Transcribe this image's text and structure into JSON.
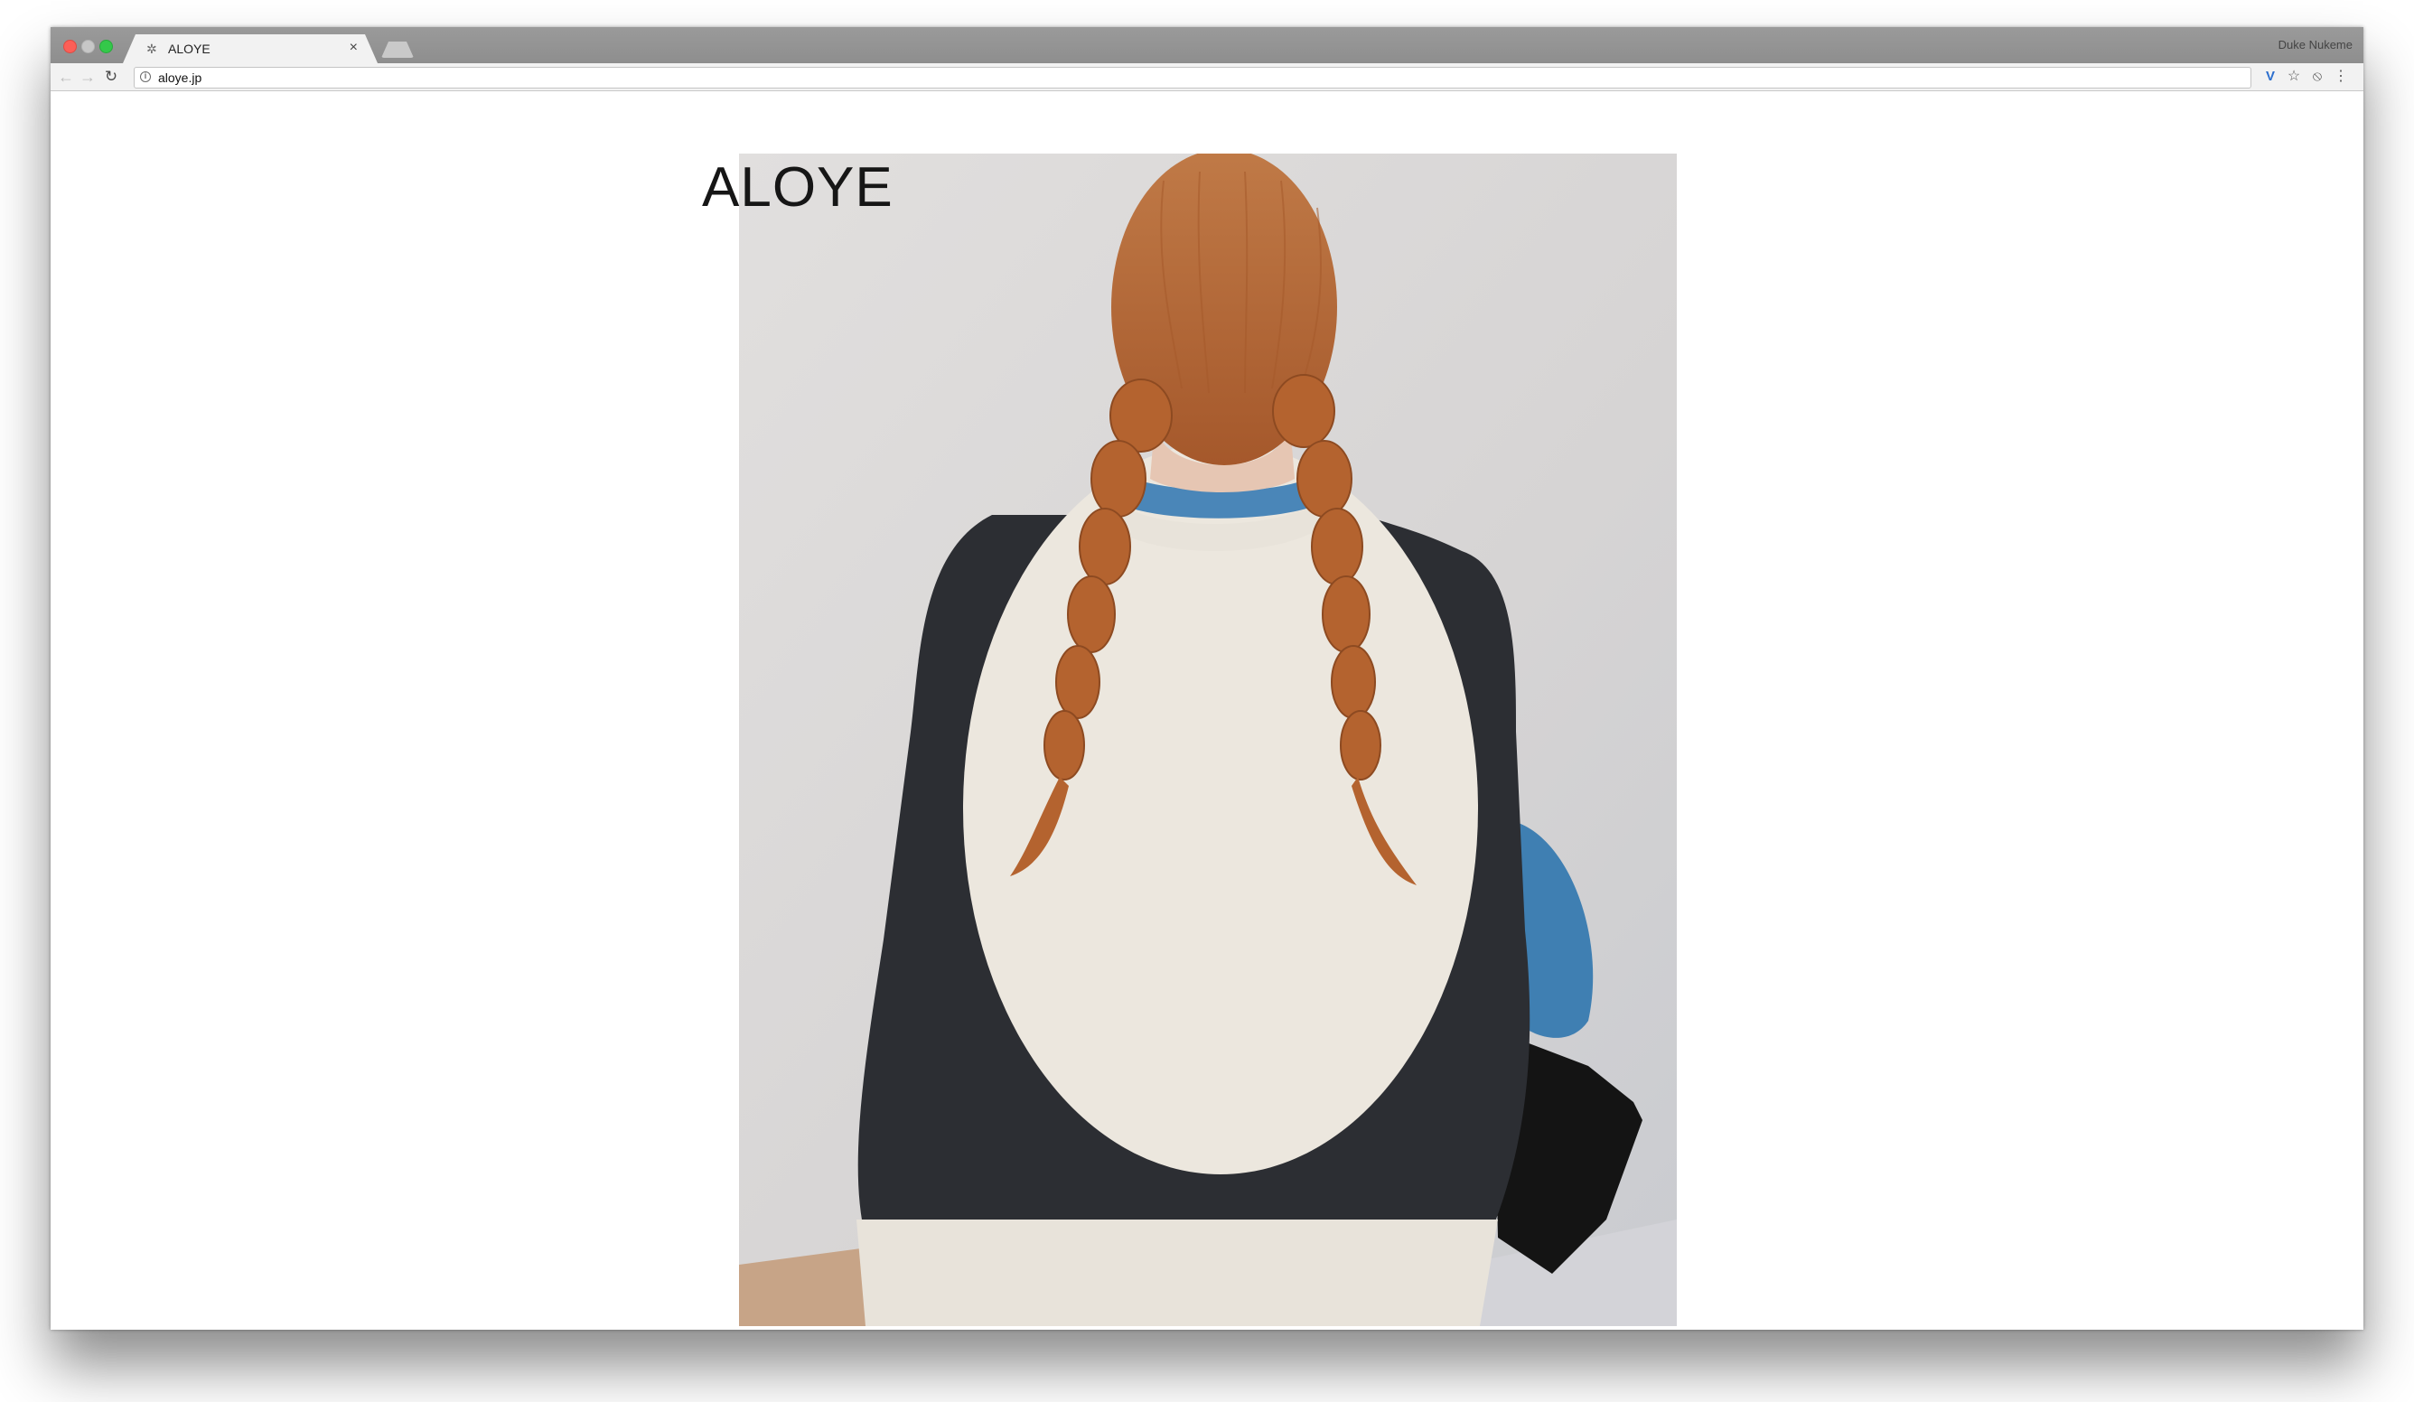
{
  "browser": {
    "tab_title": "ALOYE",
    "tab_close": "×",
    "profile_name": "Duke Nukeme",
    "url": "aloye.jp",
    "icons": {
      "back": "arrow-left-icon",
      "forward": "arrow-right-icon",
      "reload": "reload-icon",
      "info": "info-icon",
      "extension": "vivaldi-extension-icon",
      "bookmark": "star-icon",
      "extension2": "extension-icon",
      "menu": "kebab-menu-icon"
    }
  },
  "page": {
    "brand": "ALOYE",
    "hero_alt": "Photo of a person with braided red hair from behind, wearing a dark knit sweater with a large cream circle"
  },
  "colors": {
    "traffic_red": "#fc5f57",
    "traffic_green": "#34c84a",
    "sweater_dark": "#2b2d31",
    "sweater_cream": "#ece7de",
    "hair": "#b4632f",
    "background_wall": "#d9d7d6"
  }
}
